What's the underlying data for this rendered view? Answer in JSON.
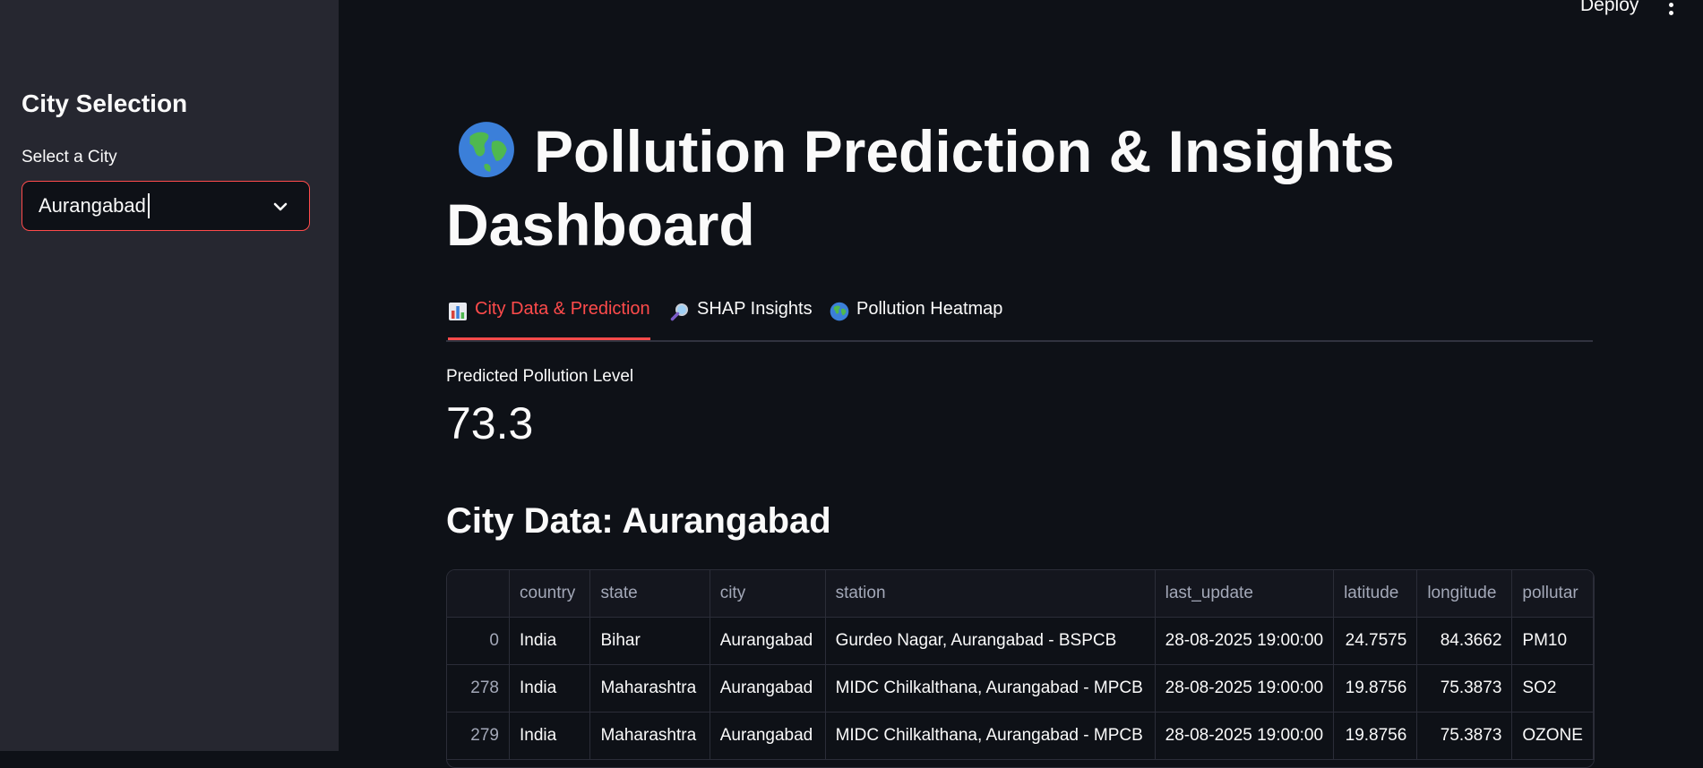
{
  "topbar": {
    "deploy_label": "Deploy"
  },
  "sidebar": {
    "title": "City Selection",
    "select_label": "Select a City",
    "selected_city": "Aurangabad"
  },
  "main": {
    "title_line1": "Pollution Prediction & Insights",
    "title_line2": "Dashboard",
    "title_icon": "globe-icon",
    "tabs": [
      {
        "label": "City Data & Prediction",
        "icon": "bar-chart-icon",
        "active": true
      },
      {
        "label": "SHAP Insights",
        "icon": "magnifier-icon",
        "active": false
      },
      {
        "label": "Pollution Heatmap",
        "icon": "globe-icon",
        "active": false
      }
    ],
    "metric": {
      "label": "Predicted Pollution Level",
      "value": "73.3"
    },
    "city_heading": "City Data: Aurangabad",
    "table": {
      "columns": [
        "",
        "country",
        "state",
        "city",
        "station",
        "last_update",
        "latitude",
        "longitude",
        "pollutar"
      ],
      "rows": [
        [
          "0",
          "India",
          "Bihar",
          "Aurangabad",
          "Gurdeo Nagar, Aurangabad - BSPCB",
          "28-08-2025 19:00:00",
          "24.7575",
          "84.3662",
          "PM10"
        ],
        [
          "278",
          "India",
          "Maharashtra",
          "Aurangabad",
          "MIDC Chilkalthana, Aurangabad - MPCB",
          "28-08-2025 19:00:00",
          "19.8756",
          "75.3873",
          "SO2"
        ],
        [
          "279",
          "India",
          "Maharashtra",
          "Aurangabad",
          "MIDC Chilkalthana, Aurangabad - MPCB",
          "28-08-2025 19:00:00",
          "19.8756",
          "75.3873",
          "OZONE"
        ]
      ]
    }
  },
  "colors": {
    "accent": "#ff4b4b",
    "background": "#0e1117",
    "sidebar": "#262730"
  }
}
